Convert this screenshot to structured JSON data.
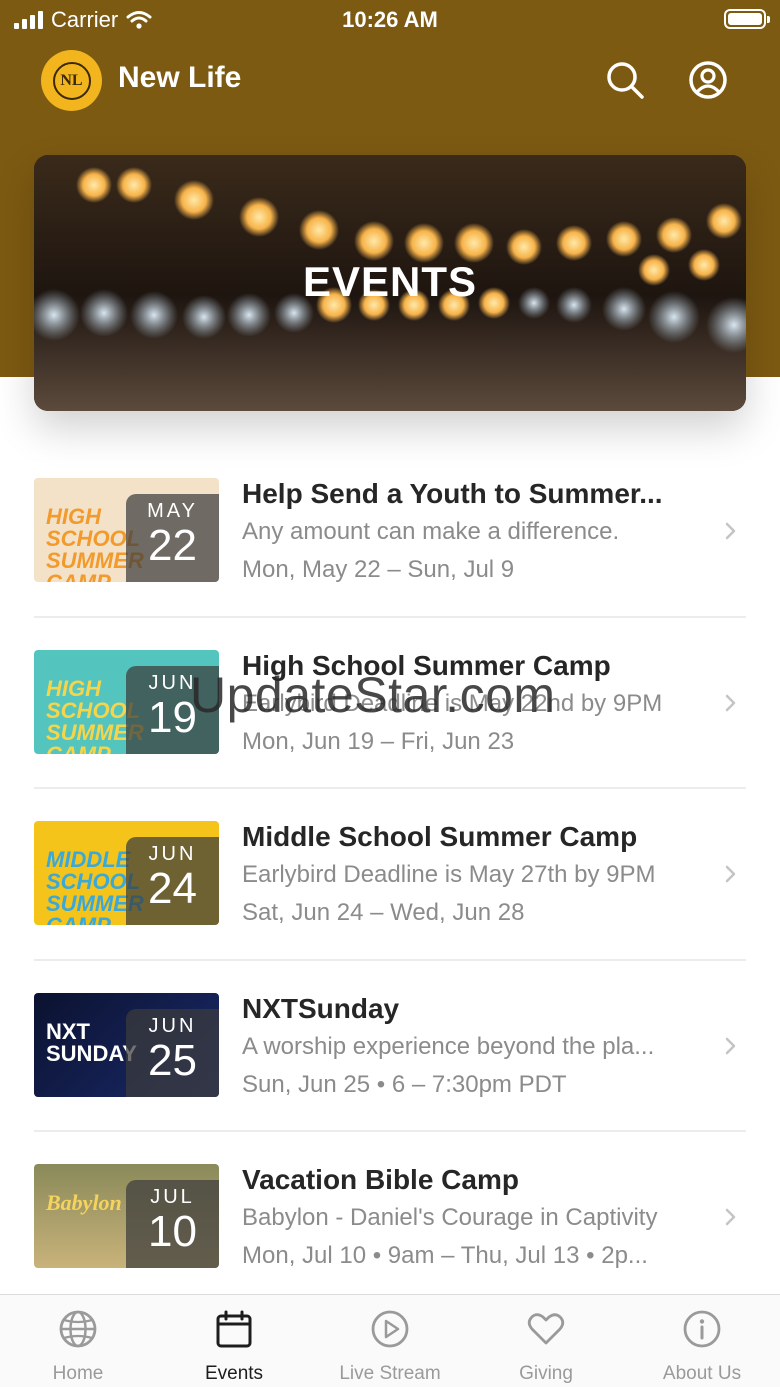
{
  "status_bar": {
    "carrier": "Carrier",
    "time": "10:26 AM"
  },
  "app": {
    "title": "New Life",
    "logo_text": "NL"
  },
  "colors": {
    "header": "#7d5a12",
    "logo": "#f2b51d"
  },
  "banner": {
    "title": "EVENTS"
  },
  "events": [
    {
      "title": "Help Send a Youth to Summer...",
      "subtitle": "Any amount can make a difference.",
      "dates": "Mon, May 22 – Sun, Jul 9",
      "month": "MAY",
      "day": "22",
      "thumb_text": "HIGH SCHOOL SUMMER CAMP"
    },
    {
      "title": "High School Summer Camp",
      "subtitle": "Earlybird Deadline is May 22nd by 9PM",
      "dates": "Mon, Jun 19 – Fri, Jun 23",
      "month": "JUN",
      "day": "19",
      "thumb_text": "HIGH SCHOOL SUMMER CAMP"
    },
    {
      "title": "Middle School Summer Camp",
      "subtitle": "Earlybird Deadline is May 27th by 9PM",
      "dates": "Sat, Jun 24 – Wed, Jun 28",
      "month": "JUN",
      "day": "24",
      "thumb_text": "MIDDLE SCHOOL SUMMER CAMP"
    },
    {
      "title": "NXTSunday",
      "subtitle": "A worship experience beyond the pla...",
      "dates": "Sun, Jun 25 • 6 – 7:30pm PDT",
      "month": "JUN",
      "day": "25",
      "thumb_text": "NXT SUNDAY"
    },
    {
      "title": "Vacation Bible Camp",
      "subtitle": "Babylon - Daniel's Courage in Captivity",
      "dates": "Mon, Jul 10 • 9am – Thu, Jul 13 • 2p...",
      "month": "JUL",
      "day": "10",
      "thumb_text": "Babylon"
    }
  ],
  "watermark": "UpdateStar.com",
  "tabs": [
    {
      "label": "Home",
      "icon": "globe-icon"
    },
    {
      "label": "Events",
      "icon": "calendar-icon"
    },
    {
      "label": "Live Stream",
      "icon": "play-circle-icon"
    },
    {
      "label": "Giving",
      "icon": "heart-icon"
    },
    {
      "label": "About Us",
      "icon": "info-icon"
    }
  ]
}
